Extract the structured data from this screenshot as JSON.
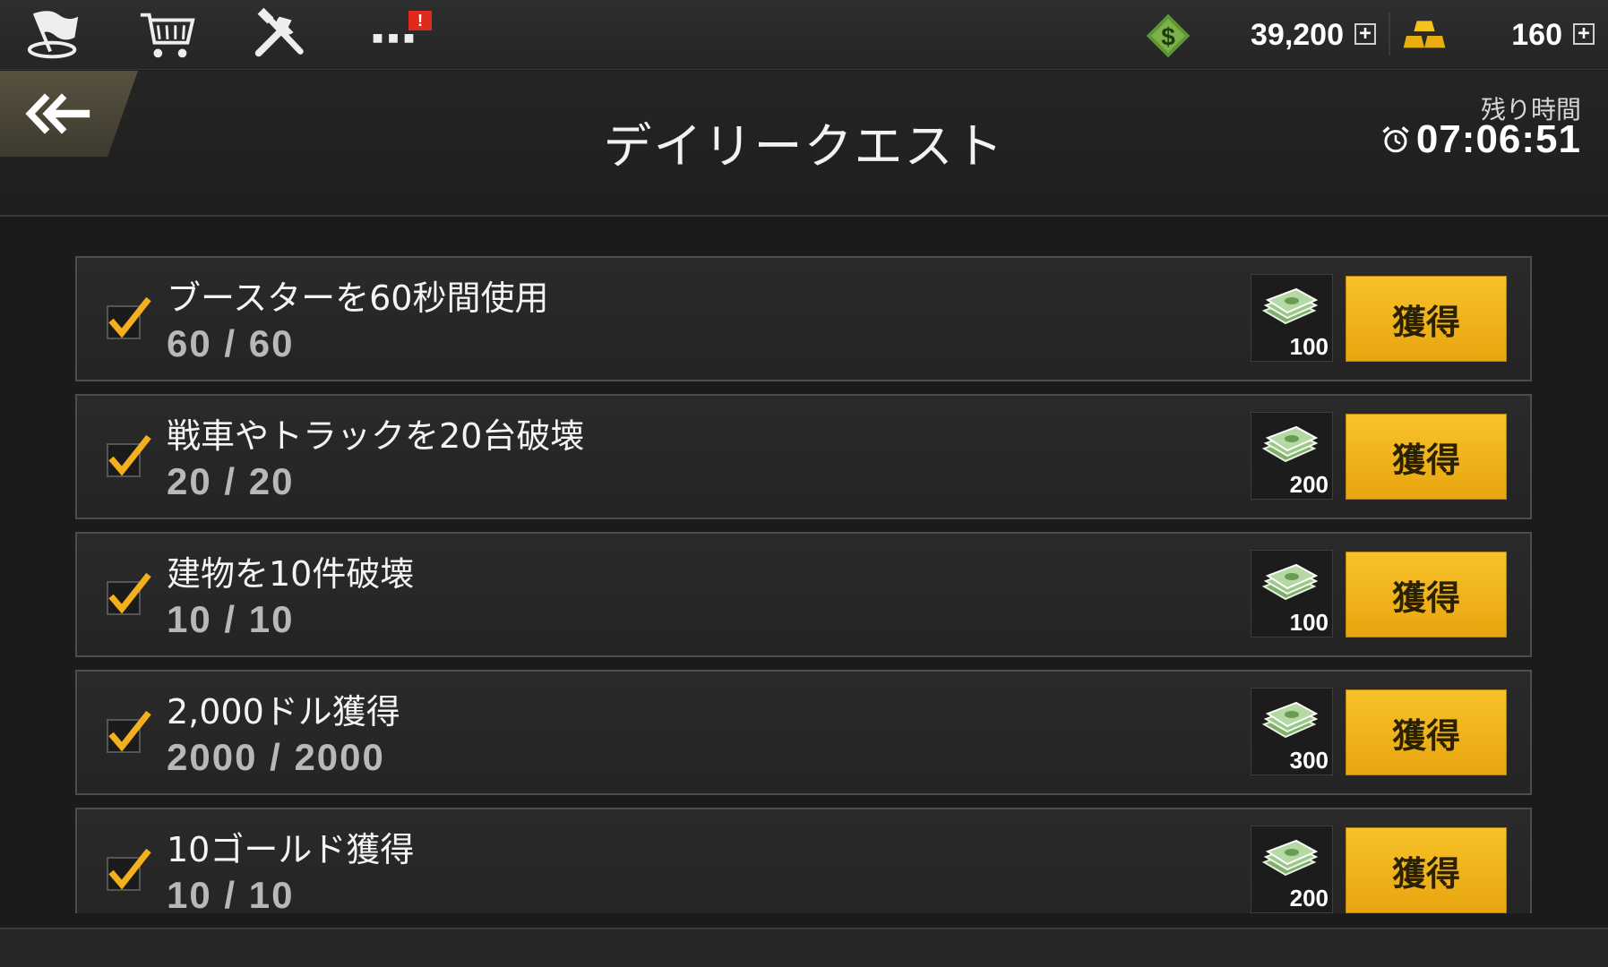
{
  "topbar": {
    "nav_icons": [
      "flag-icon",
      "cart-icon",
      "tools-icon",
      "more-icon"
    ],
    "alert_badge": "!",
    "dollars": {
      "icon": "dollar-icon",
      "value": "39,200",
      "plus": "+"
    },
    "gold": {
      "icon": "gold-bars-icon",
      "value": "160",
      "plus": "+"
    }
  },
  "header": {
    "title": "デイリークエスト",
    "remaining_label": "残り時間",
    "timer": "07:06:51"
  },
  "quests": [
    {
      "title": "ブースターを60秒間使用",
      "progress": "60 / 60",
      "reward": "100",
      "claim": "獲得"
    },
    {
      "title": "戦車やトラックを20台破壊",
      "progress": "20 / 20",
      "reward": "200",
      "claim": "獲得"
    },
    {
      "title": "建物を10件破壊",
      "progress": "10 / 10",
      "reward": "100",
      "claim": "獲得"
    },
    {
      "title": "2,000ドル獲得",
      "progress": "2000 / 2000",
      "reward": "300",
      "claim": "獲得"
    },
    {
      "title": "10ゴールド獲得",
      "progress": "10 / 10",
      "reward": "200",
      "claim": "獲得"
    }
  ],
  "colors": {
    "claim_button": "#f5b81c",
    "check": "#f2b01e",
    "dollar_green": "#6ea33d"
  }
}
